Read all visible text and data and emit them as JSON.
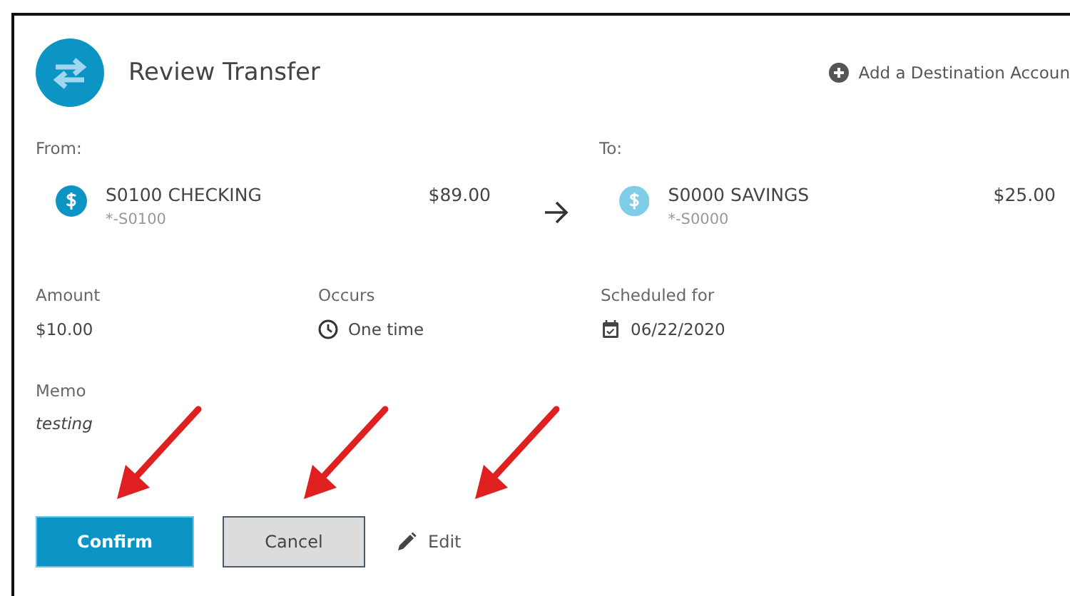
{
  "header": {
    "title": "Review Transfer",
    "add_link": "Add a Destination Accoun"
  },
  "transfer": {
    "from": {
      "label": "From:",
      "name": "S0100 CHECKING",
      "number": "*-S0100",
      "balance": "$89.00",
      "color": "#0c94c4"
    },
    "to": {
      "label": "To:",
      "name": "S0000 SAVINGS",
      "number": "*-S0000",
      "balance": "$25.00",
      "color": "#7fcde8"
    }
  },
  "details": [
    {
      "kind": "plain",
      "label": "Amount",
      "value": "$10.00"
    },
    {
      "kind": "clock",
      "label": "Occurs",
      "value": "One time"
    },
    {
      "kind": "calendar",
      "label": "Scheduled for",
      "value": "06/22/2020"
    }
  ],
  "memo": {
    "label": "Memo",
    "value": "testing"
  },
  "actions": [
    {
      "kind": "primary",
      "label": "Confirm",
      "annotated": true
    },
    {
      "kind": "secondary",
      "label": "Cancel",
      "annotated": true
    },
    {
      "kind": "edit",
      "label": "Edit",
      "annotated": true
    }
  ]
}
